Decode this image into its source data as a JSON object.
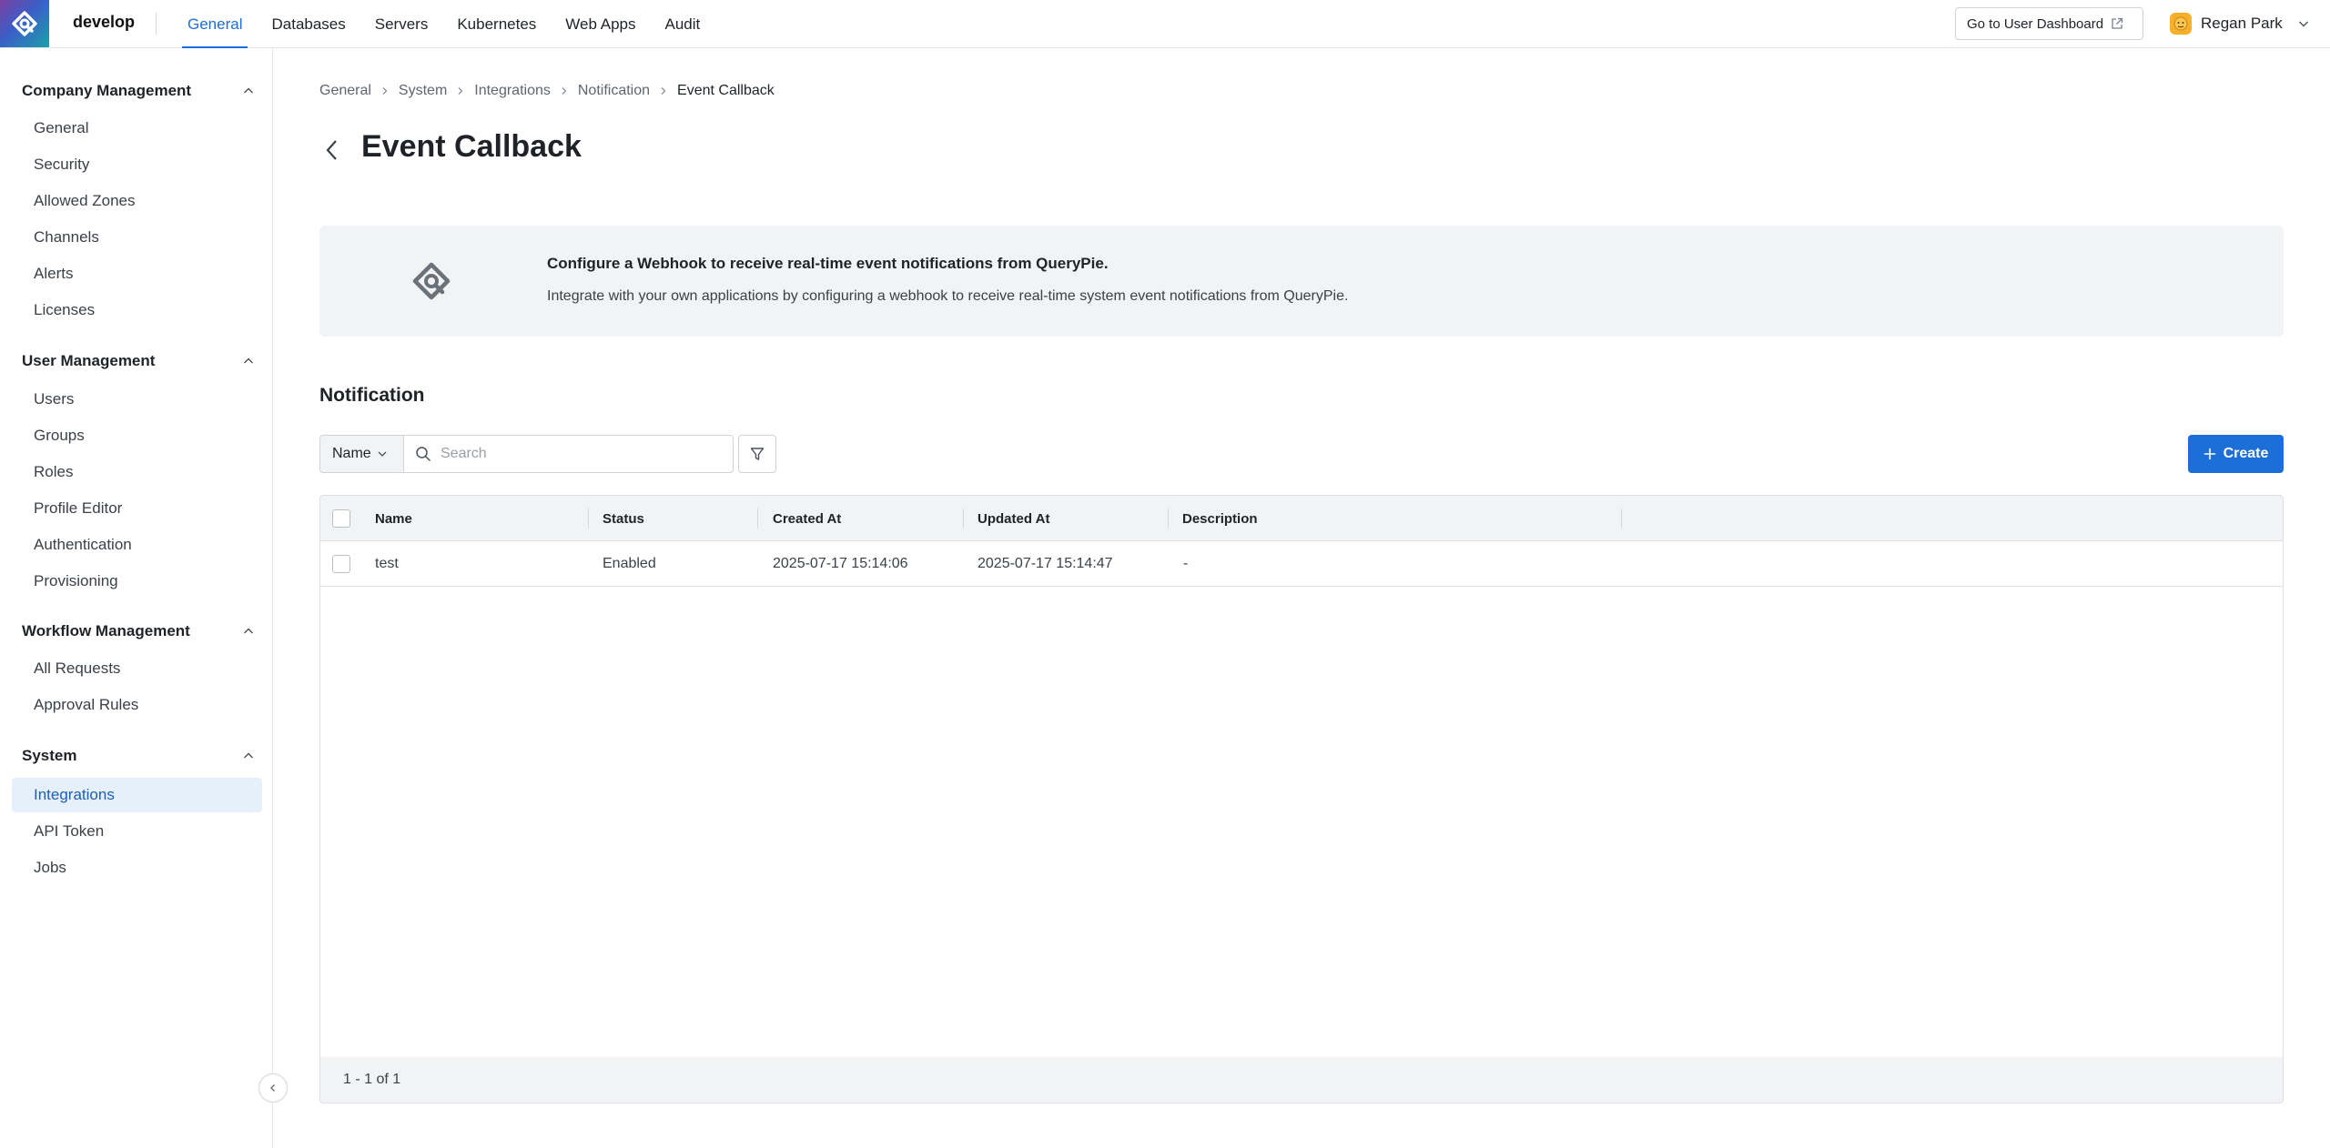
{
  "app": {
    "name": "develop"
  },
  "topnav": {
    "items": [
      {
        "label": "General",
        "active": true
      },
      {
        "label": "Databases",
        "active": false
      },
      {
        "label": "Servers",
        "active": false
      },
      {
        "label": "Kubernetes",
        "active": false
      },
      {
        "label": "Web Apps",
        "active": false
      },
      {
        "label": "Audit",
        "active": false
      }
    ],
    "dashboard_button": "Go to User Dashboard",
    "user_name": "Regan Park"
  },
  "sidebar": {
    "sections": [
      {
        "title": "Company Management",
        "items": [
          "General",
          "Security",
          "Allowed Zones",
          "Channels",
          "Alerts",
          "Licenses"
        ]
      },
      {
        "title": "User Management",
        "items": [
          "Users",
          "Groups",
          "Roles",
          "Profile Editor",
          "Authentication",
          "Provisioning"
        ]
      },
      {
        "title": "Workflow Management",
        "items": [
          "All Requests",
          "Approval Rules"
        ]
      },
      {
        "title": "System",
        "items": [
          "Integrations",
          "API Token",
          "Jobs"
        ],
        "active_item": "Integrations"
      }
    ]
  },
  "breadcrumb": [
    "General",
    "System",
    "Integrations",
    "Notification",
    "Event Callback"
  ],
  "page": {
    "title": "Event Callback"
  },
  "banner": {
    "title": "Configure a Webhook to receive real-time event notifications from QueryPie.",
    "description": "Integrate with your own applications by configuring a webhook to receive real-time system event notifications from QueryPie."
  },
  "notification": {
    "section_title": "Notification",
    "filter_field": "Name",
    "search_placeholder": "Search",
    "create_label": "Create",
    "columns": [
      "Name",
      "Status",
      "Created At",
      "Updated At",
      "Description"
    ],
    "rows": [
      {
        "name": "test",
        "status": "Enabled",
        "created_at": "2025-07-17 15:14:06",
        "updated_at": "2025-07-17 15:14:47",
        "description": "-"
      }
    ],
    "pagination": "1 - 1 of 1"
  },
  "colors": {
    "accent": "#1d6fd8",
    "active_bg": "#e6f0fb",
    "banner_bg": "#f2f3f4"
  }
}
